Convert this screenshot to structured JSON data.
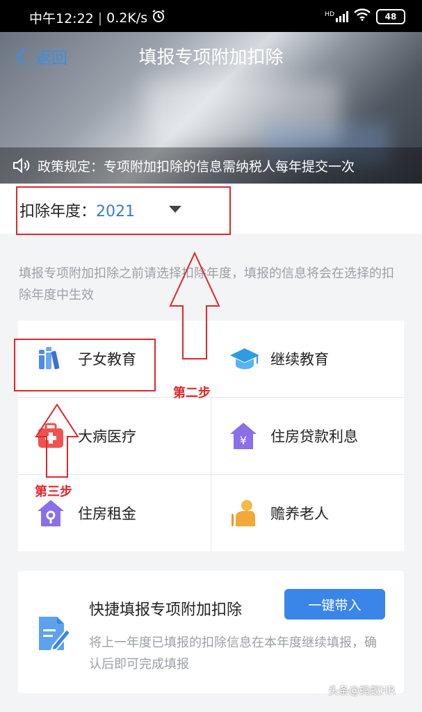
{
  "status_bar": {
    "time": "中午12:22",
    "speed": "0.2K/s",
    "network": "HD",
    "battery": "48"
  },
  "header": {
    "back_label": "返回",
    "title": "填报专项附加扣除",
    "notice": "政策规定：专项附加扣除的信息需纳税人每年提交一次"
  },
  "year_selector": {
    "label": "扣除年度：",
    "value": "2021"
  },
  "description": "填报专项附加扣除之前请选择扣除年度，填报的信息将会在选择的扣除年度中生效",
  "categories": [
    {
      "label": "子女教育",
      "icon": "books-icon"
    },
    {
      "label": "继续教育",
      "icon": "graduation-cap-icon"
    },
    {
      "label": "大病医疗",
      "icon": "medical-kit-icon"
    },
    {
      "label": "住房贷款利息",
      "icon": "house-yen-icon"
    },
    {
      "label": "住房租金",
      "icon": "house-key-icon"
    },
    {
      "label": "赡养老人",
      "icon": "elderly-person-icon"
    }
  ],
  "annotations": {
    "step2": "第二步",
    "step3": "第三步"
  },
  "quick_fill": {
    "title": "快捷填报专项附加扣除",
    "button": "一键带入",
    "description": "将上一年度已填报的扣除信息在本年度继续填报，确认后即可完成填报"
  },
  "watermark": "头条@蚂蚁HR"
}
